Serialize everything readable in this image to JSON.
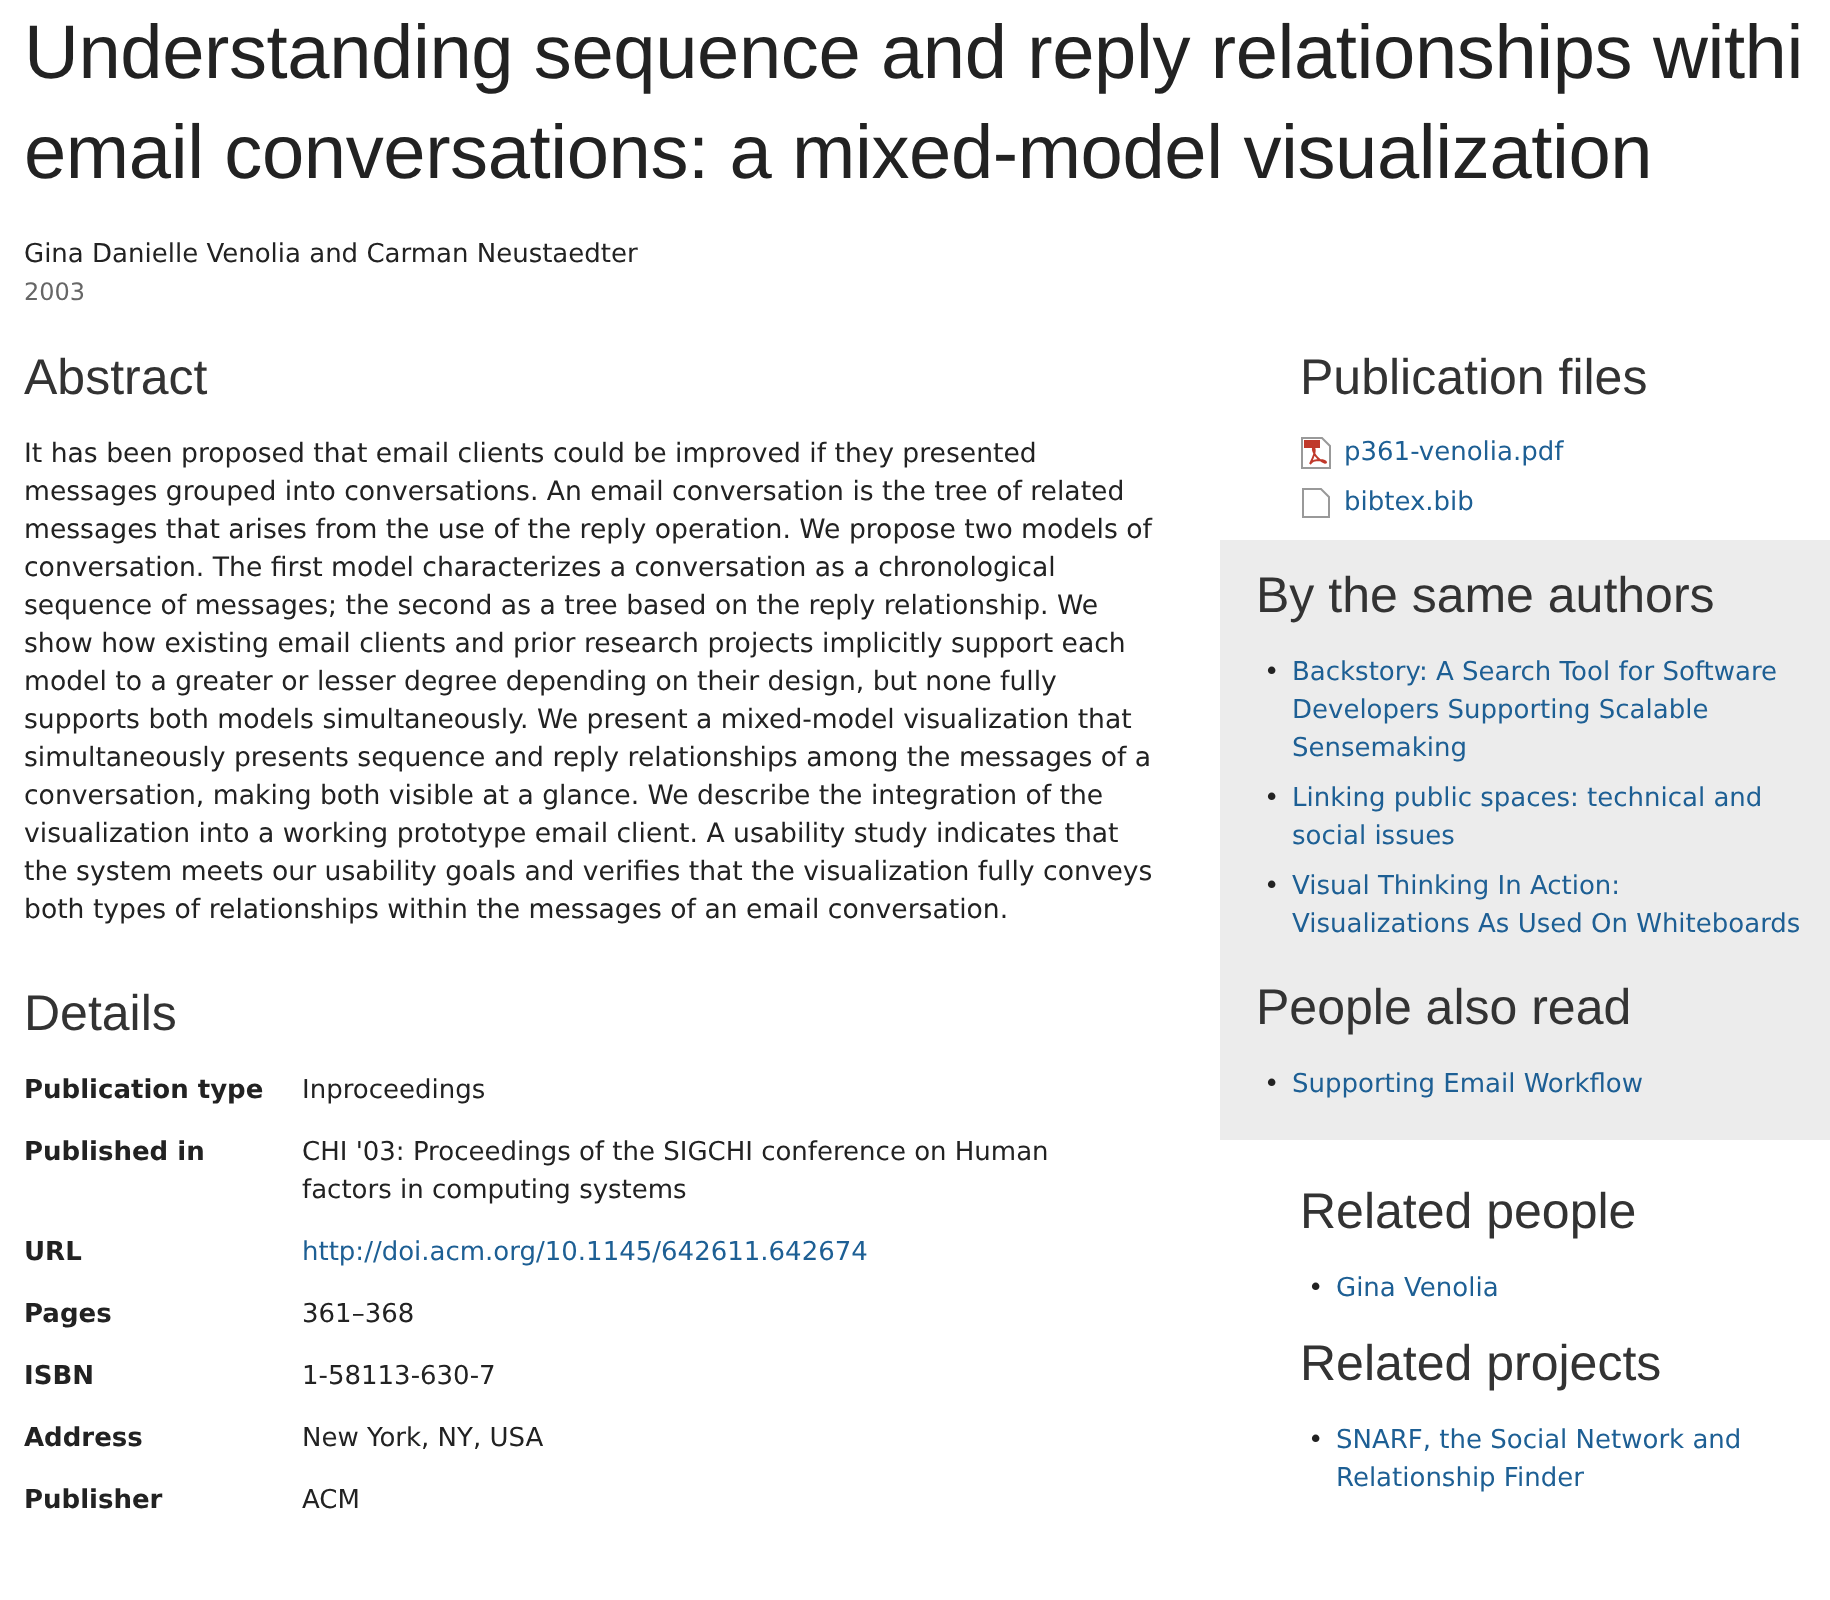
{
  "title_lines": [
    "Understanding sequence and reply relationships withi",
    "email conversations: a mixed-model visualization"
  ],
  "authors": "Gina Danielle Venolia and Carman Neustaedter",
  "year": "2003",
  "abstract": {
    "heading": "Abstract",
    "text": "It has been proposed that email clients could be improved if they presented messages grouped into conversations. An email conversation is the tree of related messages that arises from the use of the reply operation. We propose two models of conversation. The first model characterizes a conversation as a chronological sequence of messages; the second as a tree based on the reply relationship. We show how existing email clients and prior research projects implicitly support each model to a greater or lesser degree depending on their design, but none fully supports both models simultaneously. We present a mixed-model visualization that simultaneously presents sequence and reply relationships among the messages of a conversation, making both visible at a glance. We describe the integration of the visualization into a working prototype email client. A usability study indicates that the system meets our usability goals and verifies that the visualization fully conveys both types of relationships within the messages of an email conversation."
  },
  "details": {
    "heading": "Details",
    "rows": [
      {
        "label": "Publication type",
        "value": "Inproceedings",
        "kind": "text"
      },
      {
        "label": "Published in",
        "value": "CHI '03: Proceedings of the SIGCHI conference on Human factors in computing systems",
        "kind": "text"
      },
      {
        "label": "URL",
        "value": "http://doi.acm.org/10.1145/642611.642674",
        "kind": "link"
      },
      {
        "label": "Pages",
        "value": "361–368",
        "kind": "text"
      },
      {
        "label": "ISBN",
        "value": "1-58113-630-7",
        "kind": "text"
      },
      {
        "label": "Address",
        "value": "New York, NY, USA",
        "kind": "text"
      },
      {
        "label": "Publisher",
        "value": "ACM",
        "kind": "text"
      }
    ]
  },
  "publication_files": {
    "heading": "Publication files",
    "files": [
      {
        "name": "p361-venolia.pdf",
        "kind": "pdf"
      },
      {
        "name": "bibtex.bib",
        "kind": "file"
      }
    ]
  },
  "same_authors": {
    "heading": "By the same authors",
    "bullet": "•",
    "items": [
      "Backstory: A Search Tool for Software Developers Supporting Scalable Sensemaking",
      "Linking public spaces: technical and social issues",
      "Visual Thinking In Action: Visualizations As Used On Whiteboards"
    ]
  },
  "people_also_read": {
    "heading": "People also read",
    "bullet": "•",
    "items": [
      "Supporting Email Workflow"
    ]
  },
  "related_people": {
    "heading": "Related people",
    "bullet": "•",
    "items": [
      "Gina Venolia"
    ]
  },
  "related_projects": {
    "heading": "Related projects",
    "bullet": "•",
    "items": [
      "SNARF, the Social Network and Relationship Finder"
    ]
  }
}
